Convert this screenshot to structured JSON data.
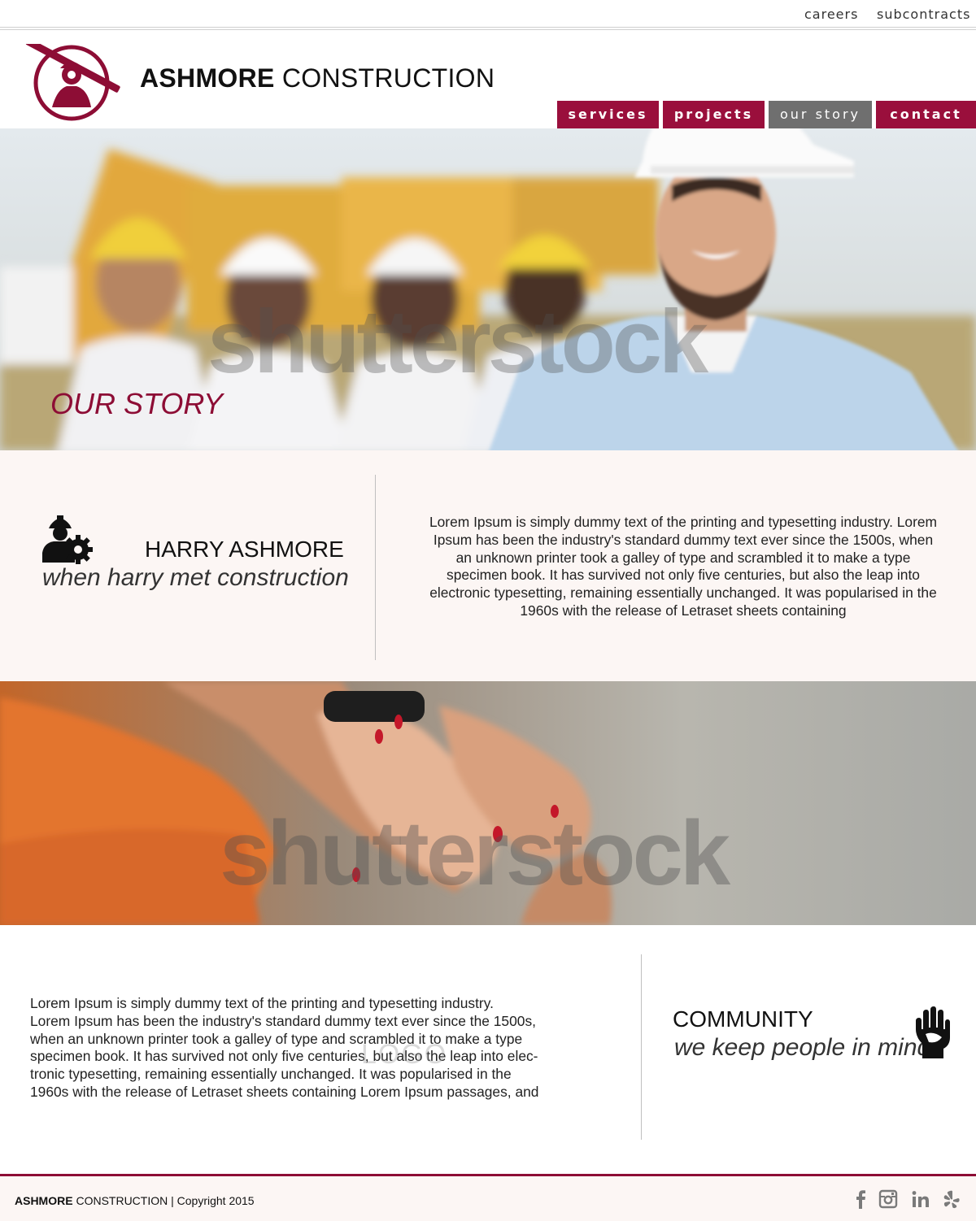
{
  "topbar": {
    "links": [
      "careers",
      "subcontracts"
    ]
  },
  "header": {
    "brand_bold": "ASHMORE",
    "brand_rest": "CONSTRUCTION",
    "logo_icon": "construction-worker-logo"
  },
  "nav": {
    "items": [
      "services",
      "projects",
      "our story",
      "contact"
    ],
    "active": "our story"
  },
  "hero": {
    "title": "OUR STORY",
    "watermark": "shutterstock"
  },
  "story": {
    "icon": "worker-gear-icon",
    "name": "HARRY ASHMORE",
    "tagline": "when harry met construction",
    "text": "Lorem Ipsum is simply dummy text of the printing and typesetting industry. Lorem Ipsum has been the industry's standard dummy text ever since  the 1500s, when an unknown printer took a galley of type and scrambled it to make a type specimen book. It has survived not only five centuries, but also the leap into electronic typesetting, remaining essentially unchanged. It was popularised in the 1960s with the release of Letraset sheets containing"
  },
  "hands_image": {
    "watermark": "shutterstock"
  },
  "community": {
    "text_lines": [
      "Lorem Ipsum is simply dummy text of the printing and typesetting industry.",
      "Lorem Ipsum has been the industry's standard dummy text ever since the 1500s,",
      "when an unknown printer took a galley of type and scrambled it to make a type",
      "specimen book. It has survived not only five centuries, but also the leap into elec-",
      "tronic typesetting, remaining essentially unchanged. It was popularised in the",
      "1960s with the release of Letraset sheets containing Lorem Ipsum passages, and"
    ],
    "ghost_logo": "LOGO",
    "title": "COMMUNITY",
    "tagline": "we keep people in mind",
    "icon": "helping-hand-icon"
  },
  "footer": {
    "brand_bold": "ASHMORE",
    "brand_rest": " CONSTRUCTION | Copyright 2015",
    "social": [
      "facebook-icon",
      "instagram-icon",
      "linkedin-icon",
      "yelp-icon"
    ]
  },
  "colors": {
    "accent": "#9a0f3c",
    "accent_dark": "#8d0d35",
    "nav_active": "#6f6f6f",
    "section_bg": "#fcf6f4"
  }
}
